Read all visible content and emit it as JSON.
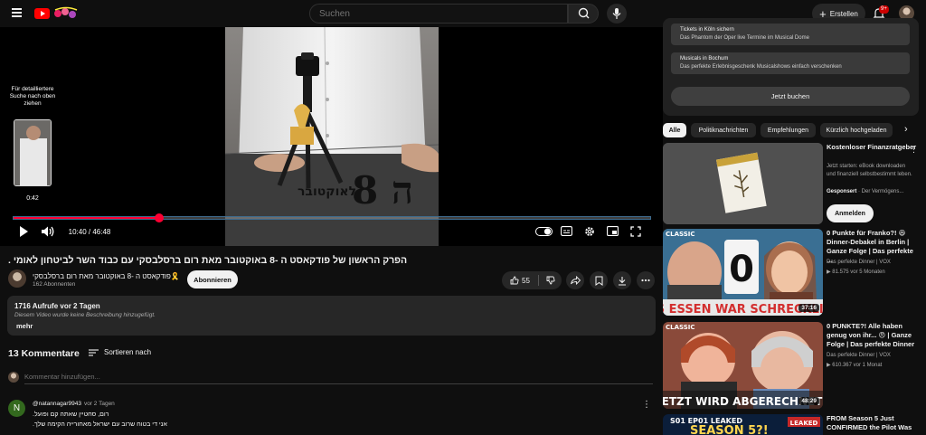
{
  "header": {
    "search_placeholder": "Suchen",
    "create_label": "Erstellen",
    "notification_count": "9+"
  },
  "player": {
    "seek_hint": "Für detailliertere Suche nach oben ziehen",
    "seek_time": "0:42",
    "time_display": "10:40 / 46:48",
    "progress_fraction": 0.228,
    "overlay_text": "8 ה",
    "overlay_sub": "לאוקטובר"
  },
  "video": {
    "title": "הפרק הראשון של פודקאסט ה -8 באוקטובר מאת רום ברסלבסקי עם כבוד השר לביטחון לאומי .",
    "channel_name": "פודקאסט ה -8 באוקטובר מאת רום ברסלבסקי🎗️",
    "subscribers": "162 Abonnenten",
    "subscribe_label": "Abonnieren",
    "likes": "55"
  },
  "description": {
    "meta": "1716 Aufrufe  vor 2 Tagen",
    "empty_text": "Diesem Video wurde keine Beschreibung hinzugefügt.",
    "more_label": "mehr"
  },
  "comments": {
    "count_label": "13 Kommentare",
    "sort_label": "Sortieren nach",
    "input_placeholder": "Kommentar hinzufügen...",
    "first": {
      "avatar_letter": "N",
      "author": "@natannagar9943",
      "ago": "vor 2 Tagen",
      "line1": "רום, סחטיין שאתה קם ופועל.",
      "line2": "אני די בטוח שרוב עם ישראל מאחורייה הקימה שלך."
    }
  },
  "sidebar": {
    "ad": {
      "item1_title": "Tickets in Köln sichern",
      "item1_sub": "Das Phantom der Oper live Termine im Musical Dome",
      "item2_title": "Musicals in Bochum",
      "item2_sub": "Das perfekte Erlebnisgeschenk Musicalshows einfach verschenken",
      "button_label": "Jetzt buchen"
    },
    "chips": [
      "Alle",
      "Politiknachrichten",
      "Empfehlungen",
      "Kürzlich hochgeladen"
    ],
    "promo": {
      "title": "Kostenloser Finanzratgeber",
      "description": "Jetzt starten: eBook downloaden und finanziell selbstbestimmt leben.",
      "sponsored_label": "Gesponsert",
      "advertiser": "· Der Vermögens...",
      "button_label": "Anmelden"
    },
    "videos": [
      {
        "title": "0 Punkte für Franko?! 😆 Dinner-Debakel in Berlin | Ganze Folge | Das perfekte ...",
        "channel": "Das perfekte Dinner | VOX",
        "meta": "▶ 81.575  vor 5 Monaten",
        "duration": "37:16",
        "thumb_text": "DAS ESSEN WAR SCHRECKLICH!",
        "thumb_badge": "CLASSIC",
        "thumb_digit": "0"
      },
      {
        "title": "0 PUNKTE?! Alle haben genug von ihr... 😠 | Ganze Folge | Das perfekte Dinner",
        "channel": "Das perfekte Dinner | VOX",
        "meta": "▶ 610.367  vor 1 Monat",
        "duration": "48:29",
        "thumb_text": "JETZT WIRD ABGERECHNET!",
        "thumb_badge": "CLASSIC"
      },
      {
        "title": "FROM Season 5 Just CONFIRMED the Pilot Was",
        "thumb_text": "SEASON 5?!",
        "thumb_top": "S01 EP01 LEAKED",
        "thumb_badge": "LEAKED"
      }
    ]
  },
  "colors": {
    "accent": "#ff0033",
    "background": "#0f0f0f"
  }
}
